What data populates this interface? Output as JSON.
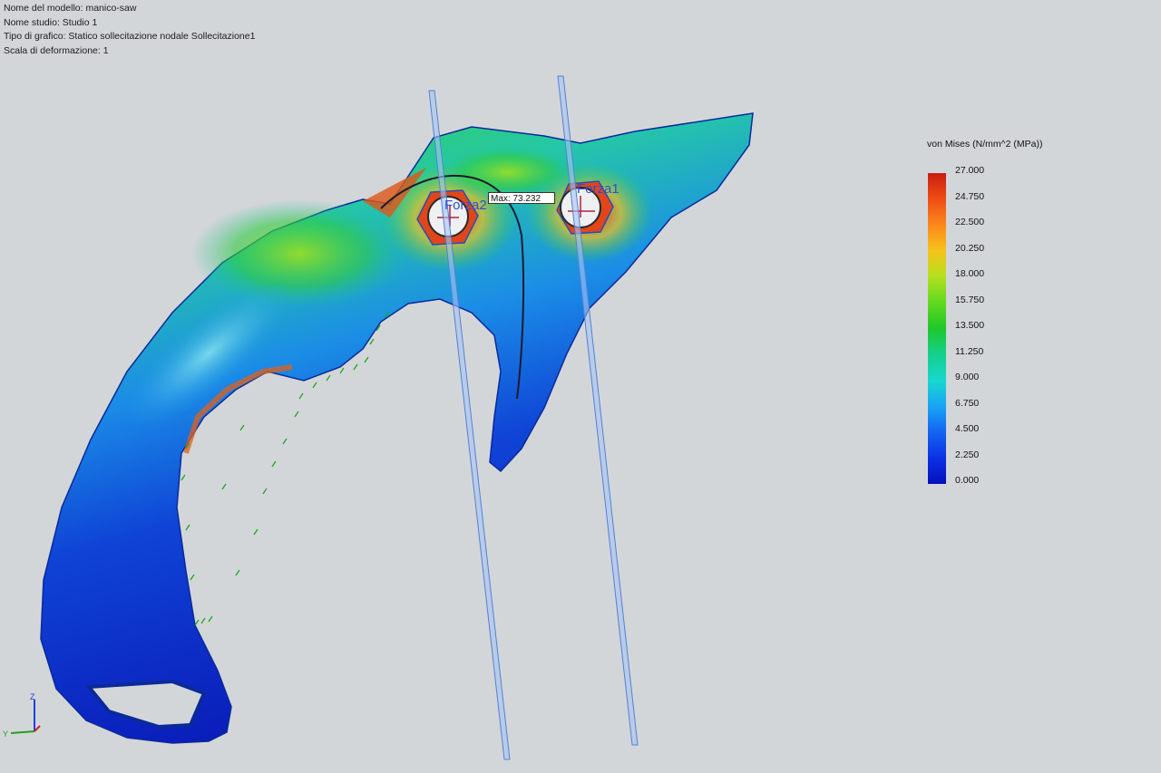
{
  "info": {
    "model_name": "Nome del modello: manico-saw",
    "study_name": "Nome studio: Studio 1",
    "plot_type": "Tipo di grafico: Statico sollecitazione nodale Sollecitazione1",
    "deformation_scale": "Scala di deformazione: 1"
  },
  "legend": {
    "title": "von Mises (N/mm^2 (MPa))",
    "ticks": [
      "27.000",
      "24.750",
      "22.500",
      "20.250",
      "18.000",
      "15.750",
      "13.500",
      "11.250",
      "9.000",
      "6.750",
      "4.500",
      "2.250",
      "0.000"
    ]
  },
  "annotations": {
    "max_label": "Max: 73.232",
    "force2_label": "Forza2",
    "force1_label": "Forza1"
  },
  "triad": {
    "y_axis": "Y",
    "z_axis": "Z"
  },
  "colors": {
    "background": "#d3d6d9",
    "stress_high": "#e02010",
    "stress_mid": "#22c82a",
    "stress_low": "#0a1bb8",
    "force_label": "#2f4fd6"
  }
}
